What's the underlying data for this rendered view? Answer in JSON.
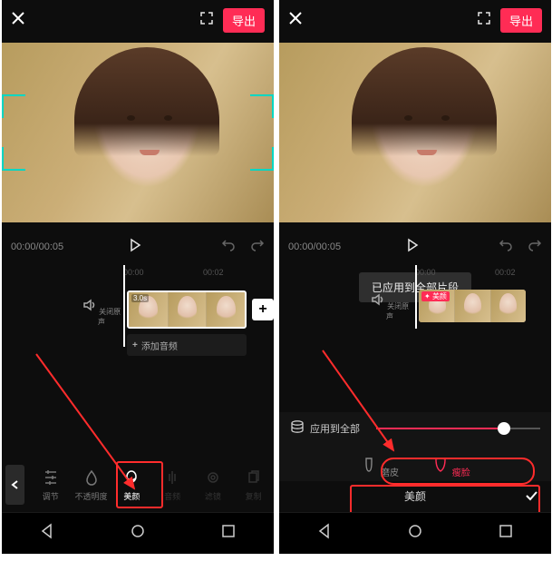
{
  "topbar": {
    "export_label": "导出"
  },
  "controls": {
    "time_display": "00:00/00:05"
  },
  "timeline": {
    "tick1": "00:00",
    "tick2": "00:02",
    "sound_label": "关闭原声",
    "clip_duration": "3.0s",
    "beauty_badge": "美颜",
    "add_audio_label": "添加音频"
  },
  "toast": {
    "applied": "已应用到全部片段"
  },
  "tools": {
    "adjust": "调节",
    "opacity": "不透明度",
    "beauty": "美颜",
    "audio": "音频",
    "filter": "滤镜",
    "copy": "复制"
  },
  "beauty": {
    "apply_all": "应用到全部",
    "smooth": "磨皮",
    "face": "瘦脸",
    "panel_title": "美颜"
  }
}
